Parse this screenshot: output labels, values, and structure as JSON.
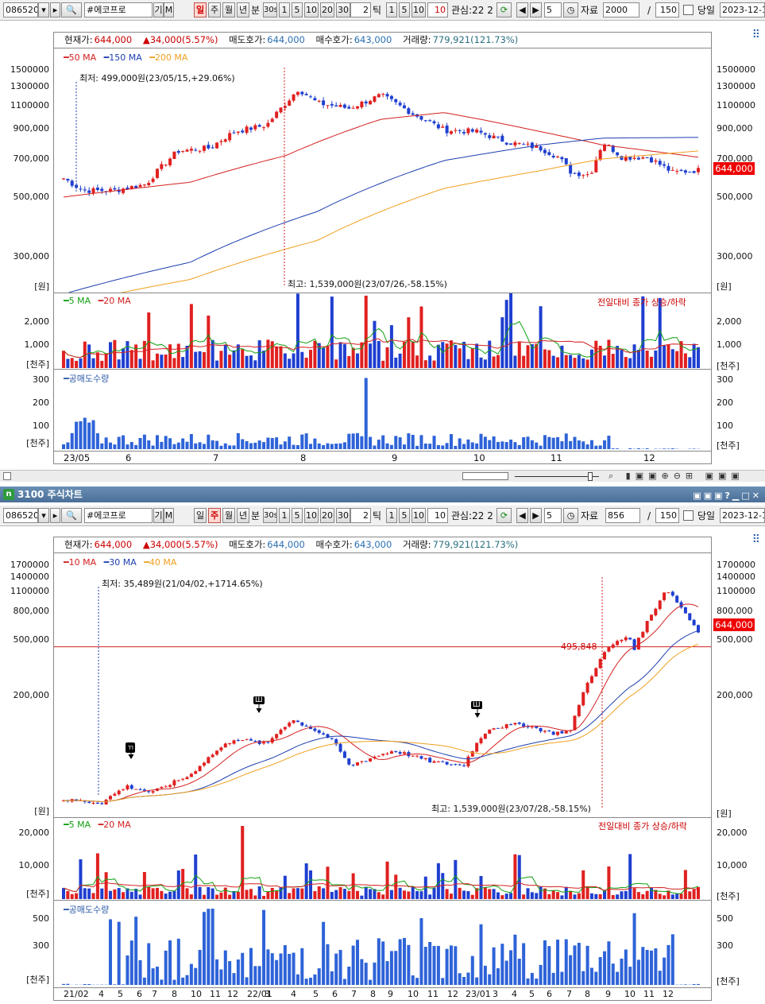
{
  "top": {
    "toolbar": {
      "code": "086520",
      "name": "#에코프로",
      "gi": "기",
      "m": "M",
      "periods": [
        "일",
        "주",
        "월",
        "년"
      ],
      "active_period": "일",
      "bun": "분",
      "min30": "30s",
      "nums": [
        "1",
        "5",
        "10",
        "20",
        "30"
      ],
      "tick_val": "2",
      "tick_label": "틱",
      "nums2": [
        "1",
        "5",
        "10"
      ],
      "val10": "10",
      "gwansim": "관심:22 2",
      "step": "5",
      "jaryo": "자료",
      "count": "2000",
      "slash": "/",
      "view": "150",
      "dangil": "당일",
      "date": "2023-12-1"
    },
    "info": {
      "price_label": "현재가:",
      "price": "644,000",
      "change": "▲34,000(5.57%)",
      "ask_label": "매도호가:",
      "ask": "644,000",
      "bid_label": "매수호가:",
      "bid": "643,000",
      "vol_label": "거래량:",
      "vol": "779,921(121.73%)"
    },
    "price_legend": [
      {
        "name": "50 MA",
        "color": "#d42020"
      },
      {
        "name": "150 MA",
        "color": "#1e3fb0"
      },
      {
        "name": "200 MA",
        "color": "#f0a020"
      }
    ],
    "low_note": "최저: 499,000원(23/05/15,+29.06%)",
    "high_note": "최고: 1,539,000원(23/07/26,-58.15%)",
    "price_ticks": [
      "1500000",
      "1300000",
      "1100000",
      "900,000",
      "700,000",
      "500,000",
      "300,000"
    ],
    "unit_won": "[원]",
    "current_tag": "644,000",
    "vol_legend": [
      {
        "name": "5 MA",
        "color": "#12a012"
      },
      {
        "name": "20 MA",
        "color": "#d42020"
      }
    ],
    "vol_note": "전일대비 종가 상승/하락",
    "vol_ticks": [
      "2,000",
      "1,000"
    ],
    "unit_k": "[천주]",
    "short_legend": "공매도수량",
    "short_ticks": [
      "300",
      "200",
      "100"
    ],
    "x_labels": [
      "23/05",
      "6",
      "7",
      "8",
      "9",
      "10",
      "11",
      "12"
    ]
  },
  "window_title": "3100 주식차트",
  "bottom": {
    "toolbar": {
      "code": "086520",
      "name": "#에코프로",
      "gi": "기",
      "m": "M",
      "periods": [
        "일",
        "주",
        "월",
        "년"
      ],
      "active_period": "주",
      "bun": "분",
      "min30": "30s",
      "nums": [
        "1",
        "5",
        "10",
        "20",
        "30"
      ],
      "tick_val": "2",
      "tick_label": "틱",
      "nums2": [
        "1",
        "5",
        "10"
      ],
      "val10": "10",
      "gwansim": "관심:22 2",
      "step": "5",
      "jaryo": "자료",
      "count": "856",
      "slash": "/",
      "view": "150",
      "dangil": "당일",
      "date": "2023-12-1"
    },
    "info": {
      "price_label": "현재가:",
      "price": "644,000",
      "change": "▲34,000(5.57%)",
      "ask_label": "매도호가:",
      "ask": "644,000",
      "bid_label": "매수호가:",
      "bid": "643,000",
      "vol_label": "거래량:",
      "vol": "779,921(121.73%)"
    },
    "price_legend": [
      {
        "name": "10 MA",
        "color": "#d42020"
      },
      {
        "name": "30 MA",
        "color": "#1e3fb0"
      },
      {
        "name": "40 MA",
        "color": "#f0a020"
      }
    ],
    "low_note": "최저: 35,489원(21/04/02,+1714.65%)",
    "high_note": "최고: 1,539,000원(23/07/28,-58.15%)",
    "level_note": "495,848",
    "markers": [
      "ㄲ",
      "Ш",
      "Ш"
    ],
    "price_ticks": [
      "1700000",
      "1400000",
      "1100000",
      "800,000",
      "500,000",
      "200,000"
    ],
    "unit_won": "[원]",
    "current_tag": "644,000",
    "vol_legend": [
      {
        "name": "5 MA",
        "color": "#12a012"
      },
      {
        "name": "20 MA",
        "color": "#d42020"
      }
    ],
    "vol_note": "전일대비 종가 상승/하락",
    "vol_ticks": [
      "20,000",
      "10,000"
    ],
    "unit_k": "[천주]",
    "short_legend": "공매도수량",
    "short_ticks": [
      "500",
      "300"
    ],
    "x_labels": [
      "21/02",
      "4",
      "5",
      "6",
      "7",
      "8",
      "10",
      "11",
      "12",
      "22/01",
      "3",
      "4",
      "5",
      "6",
      "7",
      "8",
      "9",
      "10",
      "11",
      "12",
      "23/01",
      "3",
      "4",
      "5",
      "6",
      "7",
      "8",
      "9",
      "10",
      "11",
      "12"
    ]
  },
  "chart_data": [
    {
      "type": "line",
      "title": "",
      "series": [
        {
          "name": "50 MA",
          "values": [
            520,
            600,
            700,
            850,
            1100,
            1080,
            960,
            820,
            760
          ]
        },
        {
          "name": "150 MA",
          "values": [
            220,
            280,
            400,
            560,
            720,
            830,
            850,
            850,
            850
          ]
        },
        {
          "name": "200 MA",
          "values": [
            200,
            250,
            330,
            450,
            560,
            640,
            680,
            740,
            760
          ]
        }
      ],
      "categories": [
        "23/05",
        "6",
        "7",
        "8",
        "9",
        "10",
        "11",
        "12",
        ""
      ],
      "ylim": [
        300000,
        1500000
      ]
    },
    {
      "type": "line",
      "title": "",
      "series": [
        {
          "name": "10 MA",
          "values": [
            40,
            70,
            120,
            110,
            80,
            120,
            400,
            1200,
            700
          ]
        },
        {
          "name": "30 MA",
          "values": [
            35,
            55,
            100,
            110,
            90,
            100,
            250,
            800,
            800
          ]
        },
        {
          "name": "40 MA",
          "values": [
            34,
            50,
            90,
            105,
            90,
            95,
            220,
            650,
            750
          ]
        }
      ],
      "categories": [
        "21/02",
        "6",
        "10",
        "22/01",
        "5",
        "9",
        "23/01",
        "7",
        "12"
      ],
      "ylim": [
        35000,
        1700000
      ]
    }
  ]
}
